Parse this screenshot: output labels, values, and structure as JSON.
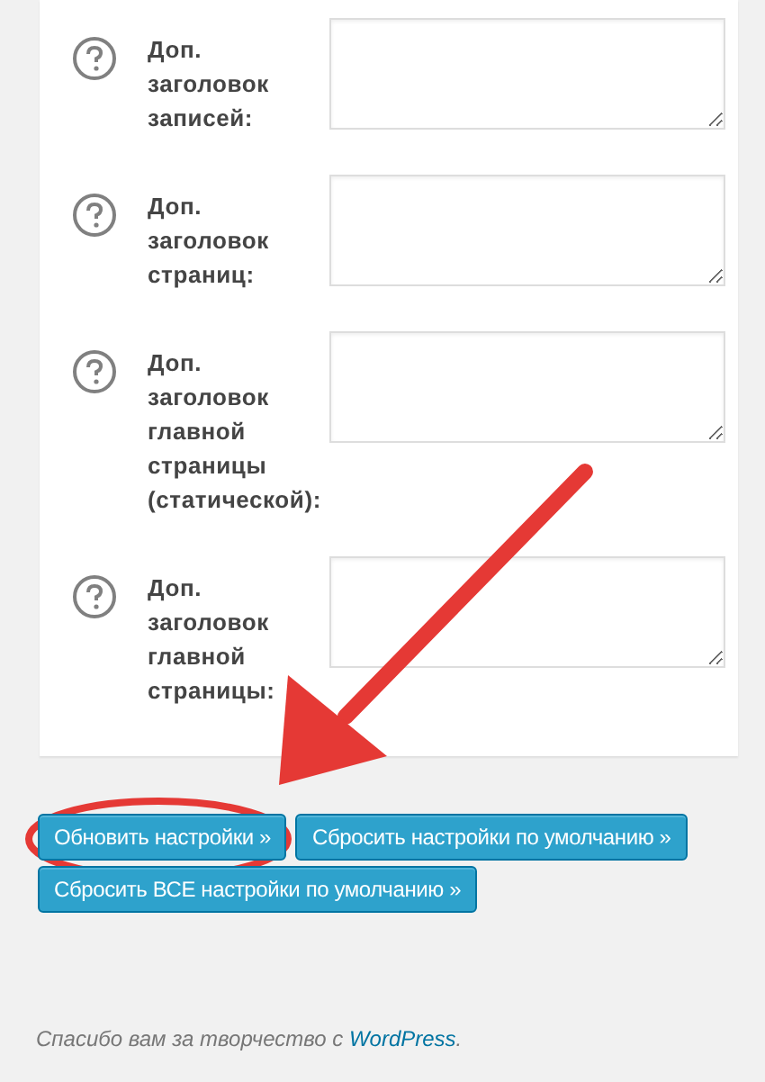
{
  "fields": [
    {
      "label": "Доп. заголовок записей:"
    },
    {
      "label": "Доп. заголовок страниц:"
    },
    {
      "label": "Доп. заголовок главной страницы (статической):"
    },
    {
      "label": "Доп. заголовок главной страницы:"
    }
  ],
  "buttons": [
    "Обновить настройки »",
    "Сбросить настройки по умолчанию »",
    "Сбросить ВСЕ настройки по умолчанию »"
  ],
  "footer": {
    "text": "Спасибо вам за творчество с ",
    "link": "WordPress",
    "after": "."
  }
}
